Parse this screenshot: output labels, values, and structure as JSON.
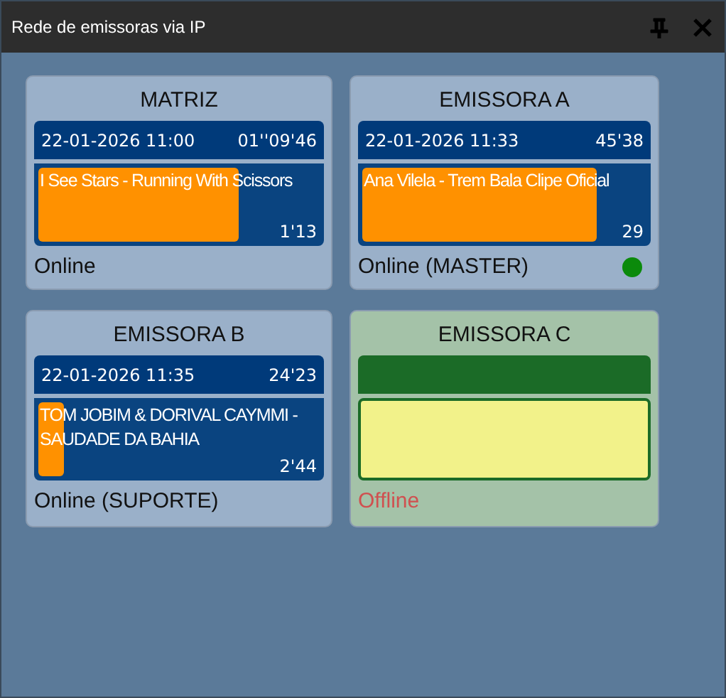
{
  "window": {
    "title": "Rede de emissoras via IP"
  },
  "stations": [
    {
      "name": "MATRIZ",
      "online": true,
      "datetime": "22-01-2026 11:00",
      "elapsed": "01''09'46",
      "track": "I See Stars - Running With Scissors",
      "level": 0.72,
      "remaining": "1'13",
      "status": "Online",
      "master_indicator": false
    },
    {
      "name": "EMISSORA A",
      "online": true,
      "datetime": "22-01-2026 11:33",
      "elapsed": "45'38",
      "track": "Ana Vilela - Trem Bala Clipe Oficial",
      "level": 0.83,
      "remaining": "29",
      "status": "Online (MASTER)",
      "master_indicator": true
    },
    {
      "name": "EMISSORA B",
      "online": true,
      "datetime": "22-01-2026 11:35",
      "elapsed": "24'23",
      "track": "TOM JOBIM & DORIVAL CAYMMI - SAUDADE DA BAHIA",
      "level": 0.12,
      "remaining": "2'44",
      "status": "Online (SUPORTE)",
      "master_indicator": false
    },
    {
      "name": "EMISSORA C",
      "online": false,
      "status": "Offline",
      "master_indicator": false
    }
  ]
}
